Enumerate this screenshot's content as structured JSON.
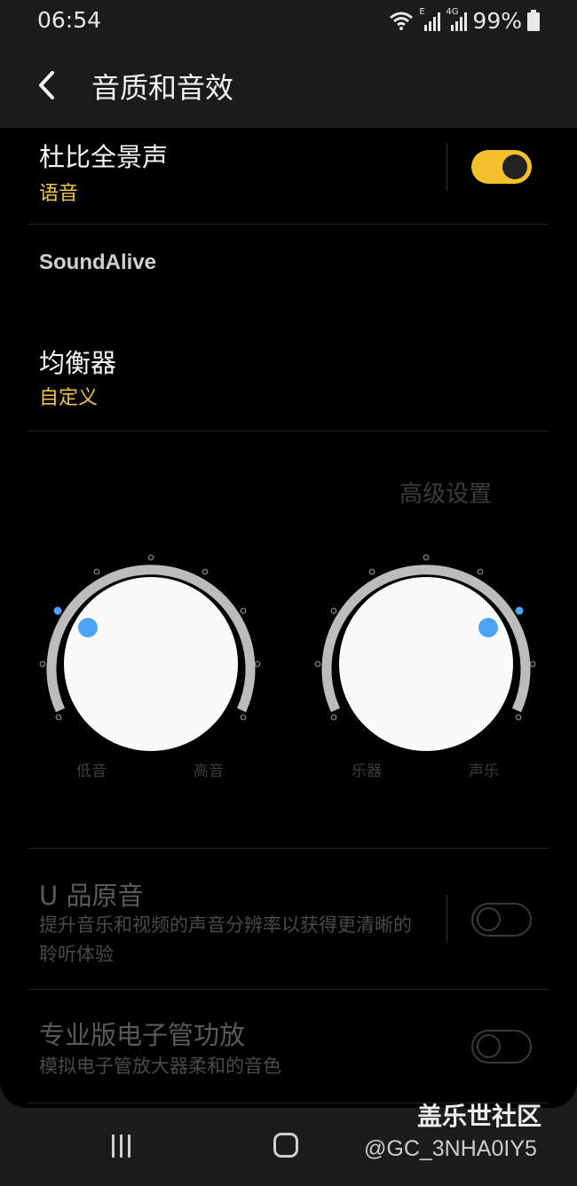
{
  "status_bar": {
    "time": "06:54",
    "network_label": "4G",
    "network_sub_label": "E",
    "battery": "99%"
  },
  "app_bar": {
    "title": "音质和音效",
    "back_icon": "chevron-left-icon"
  },
  "dolby": {
    "title": "杜比全景声",
    "subtitle": "语音",
    "enabled": true
  },
  "soundalive": {
    "header": "SoundAlive"
  },
  "equalizer": {
    "title": "均衡器",
    "subtitle": "自定义"
  },
  "advanced_label": "高级设置",
  "dials": [
    {
      "left_label": "低音",
      "right_label": "高音",
      "position": "low"
    },
    {
      "left_label": "乐器",
      "right_label": "声乐",
      "position": "high"
    }
  ],
  "uhq": {
    "title": "U 品原音",
    "subtitle": "提升音乐和视频的声音分辨率以获得更清晰的聆听体验",
    "enabled": false
  },
  "tube_amp": {
    "title": "专业版电子管功放",
    "subtitle": "模拟电子管放大器柔和的音色",
    "enabled": false
  },
  "watermark": {
    "title": "盖乐世社区",
    "user": "@GC_3NHA0IY5"
  },
  "colors": {
    "accent": "#f0c14b",
    "toggle_on": "#f4c12d",
    "dial_dot": "#4da3f5",
    "background": "#000000"
  }
}
